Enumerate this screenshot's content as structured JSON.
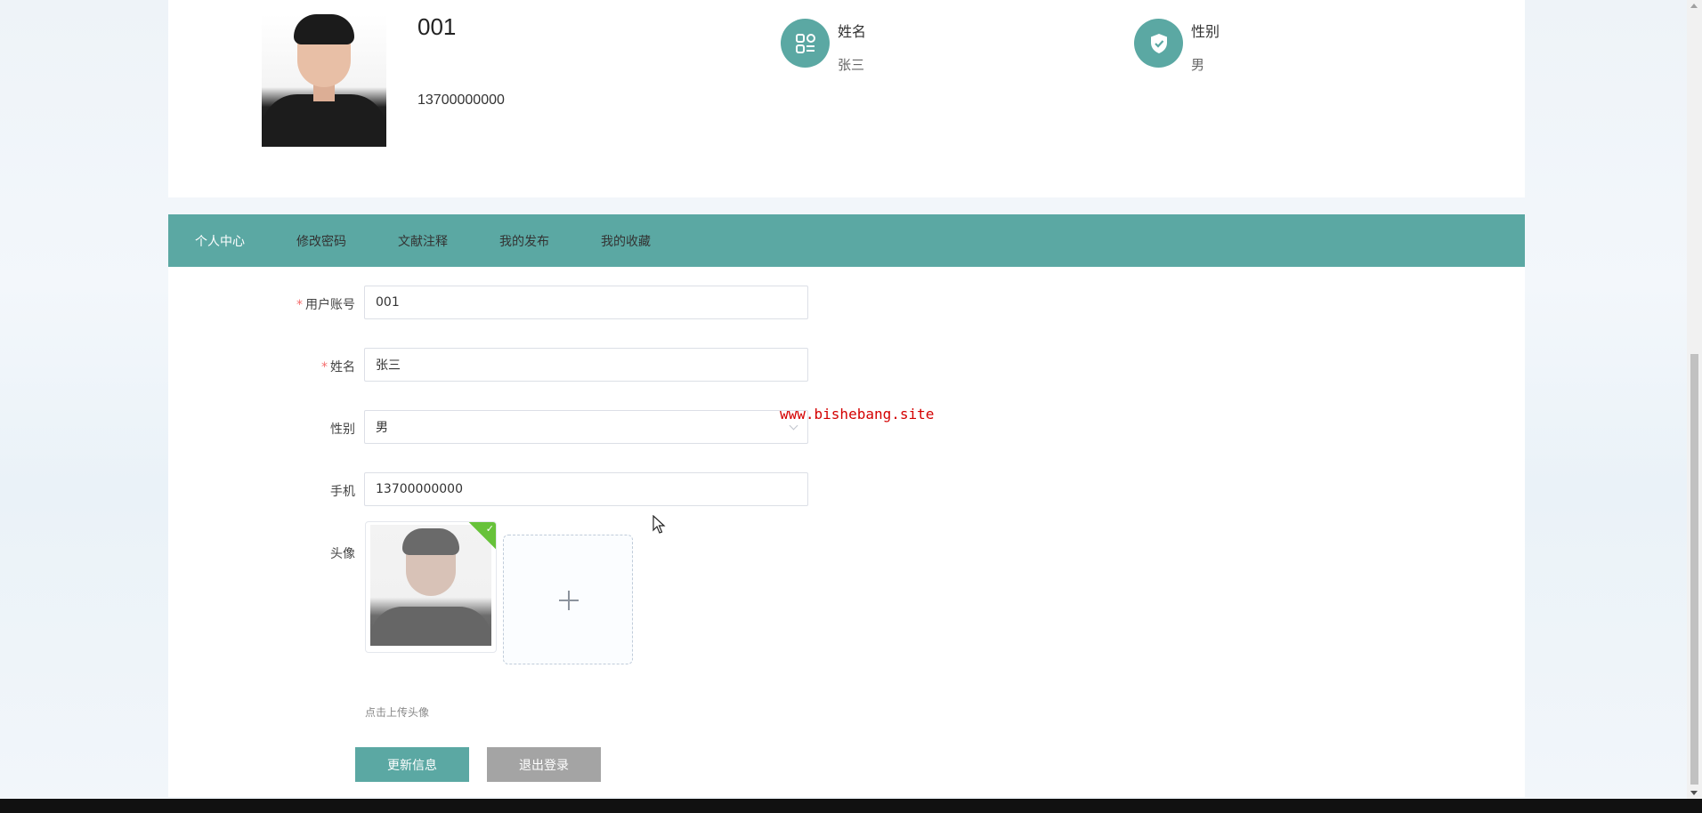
{
  "profile": {
    "account": "001",
    "phone": "13700000000",
    "name_label": "姓名",
    "name_value": "张三",
    "gender_label": "性别",
    "gender_value": "男"
  },
  "tabs": [
    {
      "label": "个人中心",
      "active": true
    },
    {
      "label": "修改密码",
      "active": false
    },
    {
      "label": "文献注释",
      "active": false
    },
    {
      "label": "我的发布",
      "active": false
    },
    {
      "label": "我的收藏",
      "active": false
    }
  ],
  "form": {
    "account": {
      "label": "用户账号",
      "required": "*",
      "value": "001"
    },
    "name": {
      "label": "姓名",
      "required": "*",
      "value": "张三"
    },
    "gender": {
      "label": "性别",
      "value": "男"
    },
    "phone": {
      "label": "手机",
      "value": "13700000000"
    },
    "avatar": {
      "label": "头像",
      "tip": "点击上传头像"
    }
  },
  "buttons": {
    "update": "更新信息",
    "logout": "退出登录"
  },
  "watermark": "www.bishebang.site",
  "colors": {
    "accent": "#5ba8a3",
    "logout_button": "#a4a4a4",
    "required": "#f56c6c",
    "watermark": "#d40000",
    "upload_success": "#67c23a"
  }
}
